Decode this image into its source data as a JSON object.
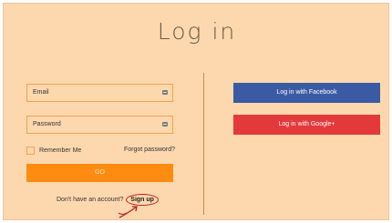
{
  "title": "Log in",
  "form": {
    "email_placeholder": "Email",
    "password_placeholder": "Password",
    "remember_label": "Remember Me",
    "forgot_label": "Forgot password?",
    "go_label": "GO",
    "no_account_text": "Don't have an account?",
    "signup_label": "Sign up"
  },
  "social": {
    "facebook_label": "Log in with Facebook",
    "google_label": "Log in with Google+"
  },
  "colors": {
    "background": "#fdd8ae",
    "accent": "#fd8c10",
    "facebook": "#3a5ba4",
    "google": "#e4393b",
    "annotation": "#c0201d"
  },
  "icons": {
    "field_icon": "card-icon",
    "annotation_arrow": "arrow-icon"
  }
}
